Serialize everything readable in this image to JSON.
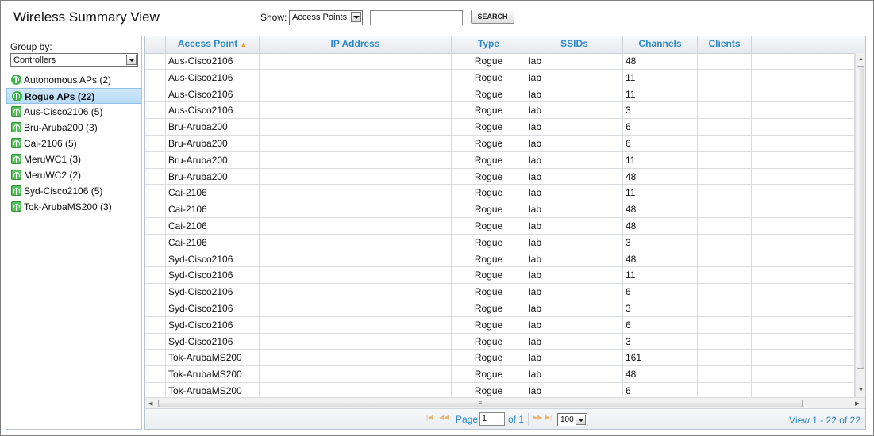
{
  "app": {
    "title": "Wireless Summary View"
  },
  "toolbar": {
    "show_label": "Show:",
    "show_value": "Access Points",
    "search_placeholder": "",
    "search_button": "SEARCH"
  },
  "sidebar": {
    "group_by_label": "Group by:",
    "group_by_value": "Controllers",
    "items": [
      {
        "label": "Autonomous APs (2)",
        "icon": "access-point-icon"
      },
      {
        "label": "Rogue APs (22)",
        "icon": "access-point-icon",
        "selected": true
      },
      {
        "label": "Aus-Cisco2106 (5)",
        "icon": "controller-icon"
      },
      {
        "label": "Bru-Aruba200 (3)",
        "icon": "controller-icon"
      },
      {
        "label": "Cai-2106 (5)",
        "icon": "controller-icon"
      },
      {
        "label": "MeruWC1 (3)",
        "icon": "controller-icon"
      },
      {
        "label": "MeruWC2 (2)",
        "icon": "controller-icon"
      },
      {
        "label": "Syd-Cisco2106 (5)",
        "icon": "controller-icon"
      },
      {
        "label": "Tok-ArubaMS200 (3)",
        "icon": "controller-icon"
      }
    ]
  },
  "table": {
    "columns": [
      "Access Point",
      "IP Address",
      "Type",
      "SSIDs",
      "Channels",
      "Clients"
    ],
    "sorted_column": "Access Point",
    "rows": [
      [
        "Aus-Cisco2106",
        "",
        "Rogue",
        "lab",
        "48",
        ""
      ],
      [
        "Aus-Cisco2106",
        "",
        "Rogue",
        "lab",
        "11",
        ""
      ],
      [
        "Aus-Cisco2106",
        "",
        "Rogue",
        "lab",
        "11",
        ""
      ],
      [
        "Aus-Cisco2106",
        "",
        "Rogue",
        "lab",
        "3",
        ""
      ],
      [
        "Bru-Aruba200",
        "",
        "Rogue",
        "lab",
        "6",
        ""
      ],
      [
        "Bru-Aruba200",
        "",
        "Rogue",
        "lab",
        "6",
        ""
      ],
      [
        "Bru-Aruba200",
        "",
        "Rogue",
        "lab",
        "11",
        ""
      ],
      [
        "Bru-Aruba200",
        "",
        "Rogue",
        "lab",
        "48",
        ""
      ],
      [
        "Cai-2106",
        "",
        "Rogue",
        "lab",
        "11",
        ""
      ],
      [
        "Cai-2106",
        "",
        "Rogue",
        "lab",
        "48",
        ""
      ],
      [
        "Cai-2106",
        "",
        "Rogue",
        "lab",
        "48",
        ""
      ],
      [
        "Cai-2106",
        "",
        "Rogue",
        "lab",
        "3",
        ""
      ],
      [
        "Syd-Cisco2106",
        "",
        "Rogue",
        "lab",
        "48",
        ""
      ],
      [
        "Syd-Cisco2106",
        "",
        "Rogue",
        "lab",
        "11",
        ""
      ],
      [
        "Syd-Cisco2106",
        "",
        "Rogue",
        "lab",
        "6",
        ""
      ],
      [
        "Syd-Cisco2106",
        "",
        "Rogue",
        "lab",
        "3",
        ""
      ],
      [
        "Syd-Cisco2106",
        "",
        "Rogue",
        "lab",
        "6",
        ""
      ],
      [
        "Syd-Cisco2106",
        "",
        "Rogue",
        "lab",
        "3",
        ""
      ],
      [
        "Tok-ArubaMS200",
        "",
        "Rogue",
        "lab",
        "161",
        ""
      ],
      [
        "Tok-ArubaMS200",
        "",
        "Rogue",
        "lab",
        "48",
        ""
      ],
      [
        "Tok-ArubaMS200",
        "",
        "Rogue",
        "lab",
        "6",
        ""
      ]
    ]
  },
  "pager": {
    "page_label": "Page",
    "page_value": "1",
    "of_label": "of 1",
    "per_page": "100",
    "view_info": "View 1 - 22 of 22"
  },
  "colors": {
    "accent": "#2b8ac7",
    "selected_bg": "#b7dbf7",
    "icon_green": "#39b54a"
  }
}
